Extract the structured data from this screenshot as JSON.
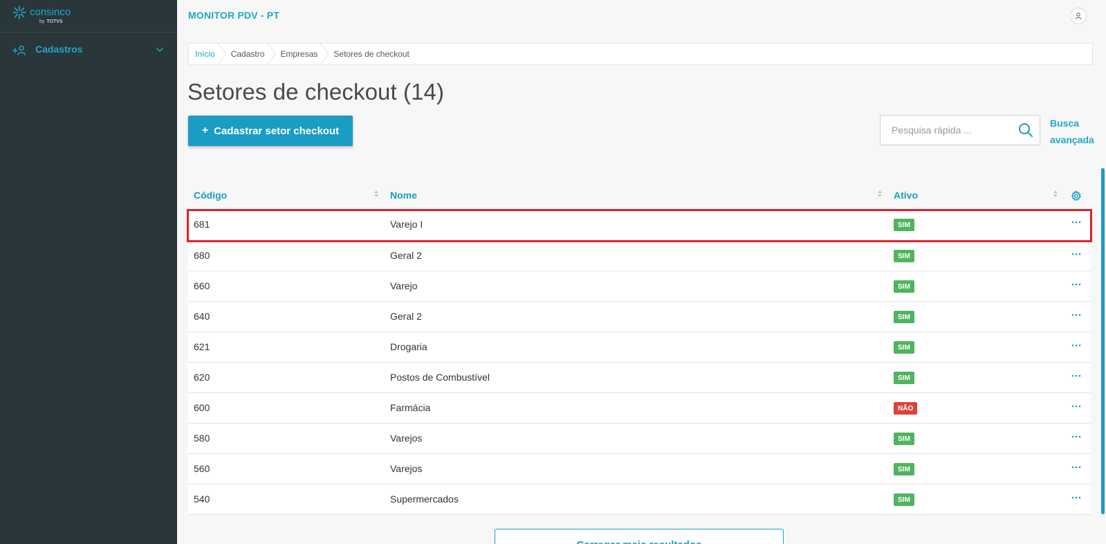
{
  "sidebar": {
    "logo": {
      "brand": "consinco",
      "by": "by",
      "parent": "TOTVS"
    },
    "menu": [
      {
        "label": "Cadastros"
      }
    ]
  },
  "header": {
    "title": "MONITOR PDV - PT"
  },
  "breadcrumb": [
    "Início",
    "Cadastro",
    "Empresas",
    "Setores de checkout"
  ],
  "page": {
    "title": "Setores de checkout (14)"
  },
  "actions": {
    "new_label": "Cadastrar setor checkout",
    "new_plus": "+"
  },
  "search": {
    "placeholder": "Pesquisa rápida ...",
    "value": "",
    "advanced_line1": "Busca",
    "advanced_line2": "avançada"
  },
  "table": {
    "columns": [
      "Código",
      "Nome",
      "Ativo"
    ],
    "rows": [
      {
        "code": "681",
        "name": "Varejo I",
        "active": "SIM"
      },
      {
        "code": "680",
        "name": "Geral 2",
        "active": "SIM"
      },
      {
        "code": "660",
        "name": "Varejo",
        "active": "SIM"
      },
      {
        "code": "640",
        "name": "Geral 2",
        "active": "SIM"
      },
      {
        "code": "621",
        "name": "Drogaria",
        "active": "SIM"
      },
      {
        "code": "620",
        "name": "Postos de Combustível",
        "active": "SIM"
      },
      {
        "code": "600",
        "name": "Farmácia",
        "active": "NÃO"
      },
      {
        "code": "580",
        "name": "Varejos",
        "active": "SIM"
      },
      {
        "code": "560",
        "name": "Varejos",
        "active": "SIM"
      },
      {
        "code": "540",
        "name": "Supermercados",
        "active": "SIM"
      }
    ]
  },
  "load_more": {
    "label": "Carregar mais resultados"
  },
  "colors": {
    "accent": "#1a9cc4",
    "sidebar_bg": "#29363a",
    "yes": "#4fb45f",
    "no": "#d9433b",
    "highlight": "#e0202a"
  }
}
